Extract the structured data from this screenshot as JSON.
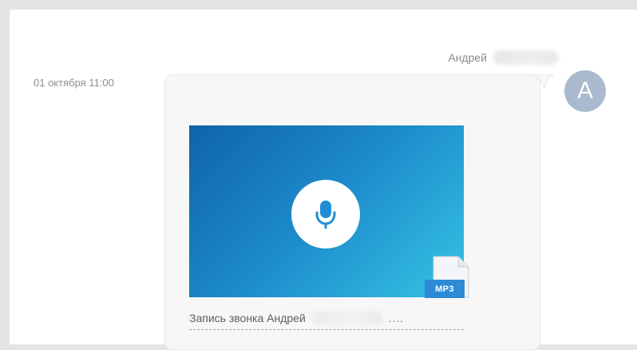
{
  "message": {
    "author": "Андрей",
    "timestamp": "01 октября 11:00",
    "avatar_letter": "А"
  },
  "attachment": {
    "title": "Запись звонка Андрей",
    "file_type": "MP3",
    "icons": {
      "microphone": "microphone-icon",
      "file": "mp3-file-icon"
    }
  },
  "colors": {
    "avatar": "#A9B9CE",
    "cover_start": "#0F64A9",
    "cover_end": "#36C4E4",
    "mp3_badge": "#2D8BD6"
  }
}
